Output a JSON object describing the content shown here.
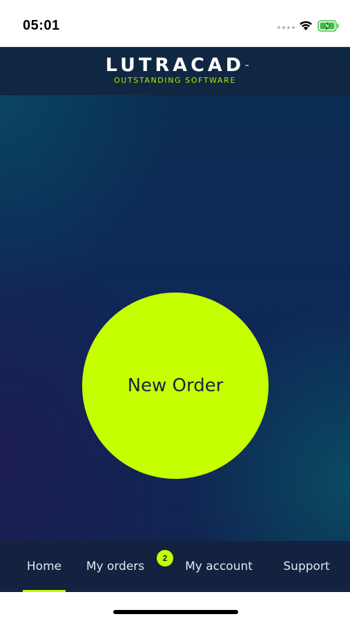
{
  "status_bar": {
    "time": "05:01",
    "icons": [
      "signal-dots-icon",
      "wifi-icon",
      "battery-charging-icon"
    ]
  },
  "header": {
    "logo_text": "LUTRACAD",
    "logo_tm": "™",
    "tagline": "OUTSTANDING SOFTWARE"
  },
  "main": {
    "new_order_label": "New Order"
  },
  "tab_bar": {
    "tabs": [
      {
        "label": "Home",
        "active": true
      },
      {
        "label": "My orders",
        "active": false
      },
      {
        "label": "My account",
        "active": false
      },
      {
        "label": "Support",
        "active": false
      }
    ],
    "orders_badge_count": "2"
  },
  "colors": {
    "accent": "#c6ff00",
    "header_bg": "#0f2743",
    "tab_bar_bg": "#14213f",
    "main_bg": "#0e2857",
    "button_text": "#1c2340"
  }
}
